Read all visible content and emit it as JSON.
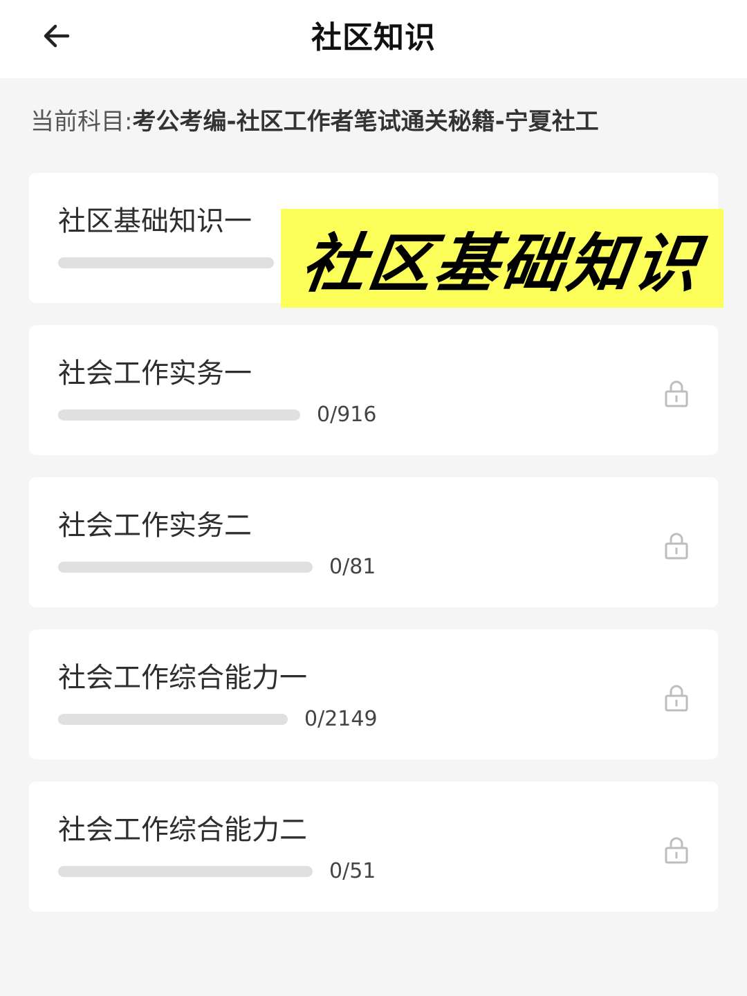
{
  "header": {
    "title": "社区知识",
    "back_icon": "arrow-left-icon"
  },
  "subject": {
    "label": "当前科目:",
    "value": "考公考编-社区工作者笔试通关秘籍-宁夏社工"
  },
  "overlay": {
    "text": "社区基础知识",
    "background": "#fcff5a"
  },
  "colors": {
    "progress_track": "#e0e0e0",
    "lock_icon": "#bdbdbd"
  },
  "modules": [
    {
      "title": "社区基础知识一",
      "count": "",
      "progress": 0,
      "locked": false
    },
    {
      "title": "社会工作实务一",
      "count": "0/916",
      "progress": 0,
      "locked": true
    },
    {
      "title": "社会工作实务二",
      "count": "0/81",
      "progress": 0,
      "locked": true
    },
    {
      "title": "社会工作综合能力一",
      "count": "0/2149",
      "progress": 0,
      "locked": true
    },
    {
      "title": "社会工作综合能力二",
      "count": "0/51",
      "progress": 0,
      "locked": true
    }
  ]
}
